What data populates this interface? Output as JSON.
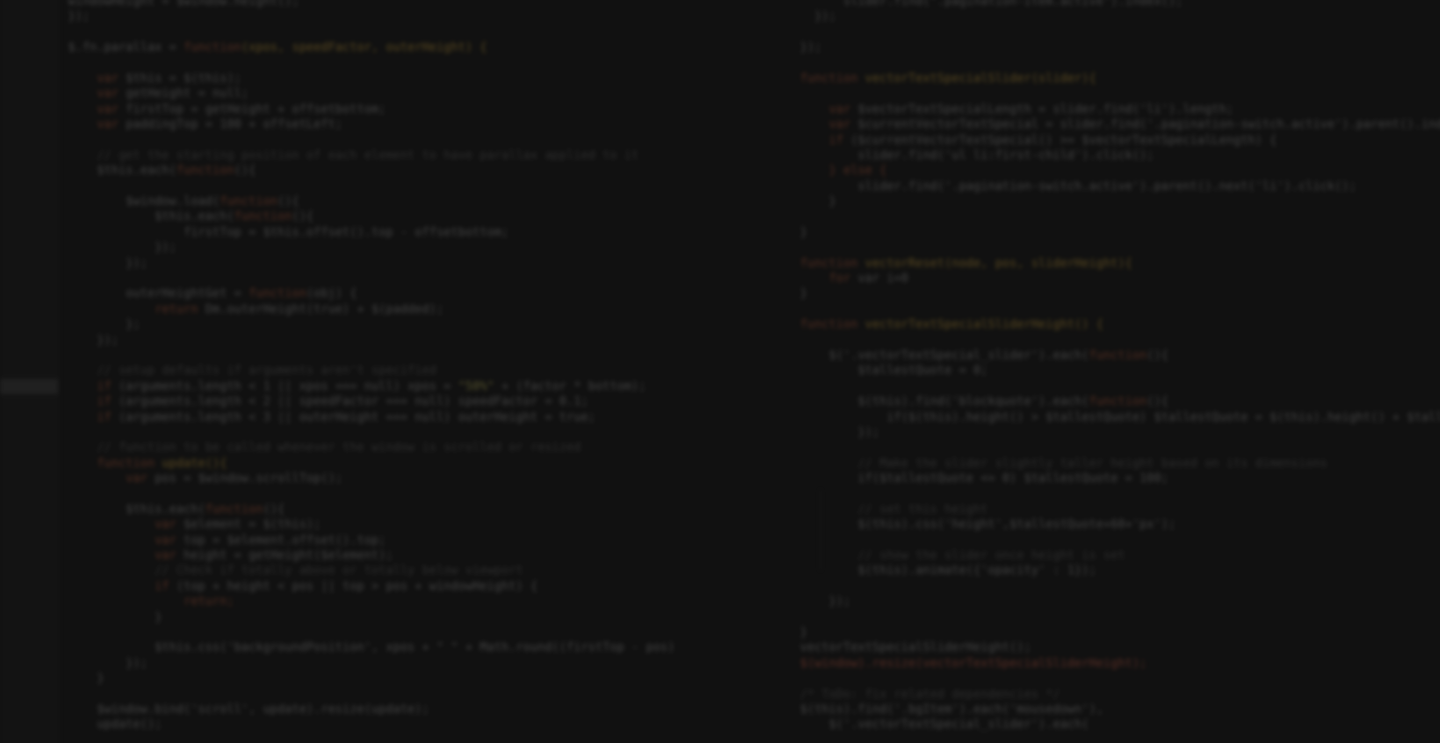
{
  "editor": {
    "active_line_index": 25,
    "line_numbers": [
      "",
      "",
      "",
      "",
      "",
      "",
      "",
      "",
      "",
      "",
      "",
      "",
      "",
      "",
      "",
      "",
      "",
      "",
      "",
      "",
      "",
      "",
      "",
      "",
      "",
      "",
      "",
      "",
      "",
      "",
      "",
      "",
      "",
      "",
      "",
      "",
      "",
      "",
      "",
      "",
      "",
      "",
      "",
      "",
      "",
      "",
      "",
      "",
      ""
    ],
    "left_lines": [
      [
        {
          "t": "windowHeight = $window.height();",
          "c": "var"
        }
      ],
      [
        {
          "t": "});",
          "c": "var"
        }
      ],
      [
        {
          "t": "",
          "c": "var"
        }
      ],
      [
        {
          "t": "$.fn.parallax = ",
          "c": "var"
        },
        {
          "t": "function",
          "c": "kw"
        },
        {
          "t": "(xpos, speedFactor, outerHeight) {",
          "c": "fn"
        }
      ],
      [
        {
          "t": "",
          "c": "var"
        }
      ],
      [
        {
          "t": "    var ",
          "c": "kw"
        },
        {
          "t": "$this = $(this);",
          "c": "var"
        }
      ],
      [
        {
          "t": "    var ",
          "c": "kw"
        },
        {
          "t": "getHeight = null;",
          "c": "var"
        }
      ],
      [
        {
          "t": "    var ",
          "c": "kw"
        },
        {
          "t": "firstTop = getHeight + offsetbottom;",
          "c": "var"
        }
      ],
      [
        {
          "t": "    var ",
          "c": "kw"
        },
        {
          "t": "paddingTop = 100 + offsetLeft;",
          "c": "var"
        }
      ],
      [
        {
          "t": "",
          "c": "var"
        }
      ],
      [
        {
          "t": "    // get the starting position of each element to have parallax applied to it",
          "c": "cm"
        }
      ],
      [
        {
          "t": "    $this.each(",
          "c": "var"
        },
        {
          "t": "function",
          "c": "kw"
        },
        {
          "t": "(){",
          "c": "var"
        }
      ],
      [
        {
          "t": "",
          "c": "var"
        }
      ],
      [
        {
          "t": "        $window.load(",
          "c": "var"
        },
        {
          "t": "function",
          "c": "kw"
        },
        {
          "t": "(){",
          "c": "var"
        }
      ],
      [
        {
          "t": "            $this.each(",
          "c": "var"
        },
        {
          "t": "function",
          "c": "kw"
        },
        {
          "t": "(){",
          "c": "var"
        }
      ],
      [
        {
          "t": "                firstTop = $this.offset().top - offsetbottom;",
          "c": "var"
        }
      ],
      [
        {
          "t": "            });",
          "c": "var"
        }
      ],
      [
        {
          "t": "        });",
          "c": "var"
        }
      ],
      [
        {
          "t": "",
          "c": "var"
        }
      ],
      [
        {
          "t": "        outerHeightGet = ",
          "c": "var"
        },
        {
          "t": "function",
          "c": "kw"
        },
        {
          "t": "(obj) {",
          "c": "var"
        }
      ],
      [
        {
          "t": "            return ",
          "c": "kw"
        },
        {
          "t": "Dm.outerHeight(true) + $(padded);",
          "c": "var"
        }
      ],
      [
        {
          "t": "        };",
          "c": "var"
        }
      ],
      [
        {
          "t": "    });",
          "c": "var"
        }
      ],
      [
        {
          "t": "",
          "c": "var"
        }
      ],
      [
        {
          "t": "    // setup defaults if arguments aren't specified",
          "c": "cm"
        }
      ],
      [
        {
          "t": "    if ",
          "c": "kw"
        },
        {
          "t": "(arguments.length < 1 || xpos === null) xpos = ",
          "c": "var"
        },
        {
          "t": "\"50%\"",
          "c": "str"
        },
        {
          "t": " + (factor * bottom);",
          "c": "var"
        }
      ],
      [
        {
          "t": "    if ",
          "c": "kw"
        },
        {
          "t": "(arguments.length < 2 || speedFactor === null) speedFactor = 0.1;",
          "c": "var"
        }
      ],
      [
        {
          "t": "    if ",
          "c": "kw"
        },
        {
          "t": "(arguments.length < 3 || outerHeight === null) outerHeight = true;",
          "c": "var"
        }
      ],
      [
        {
          "t": "",
          "c": "var"
        }
      ],
      [
        {
          "t": "    // function to be called whenever the window is scrolled or resized",
          "c": "cm"
        }
      ],
      [
        {
          "t": "    function ",
          "c": "kw"
        },
        {
          "t": "update(){",
          "c": "fn"
        }
      ],
      [
        {
          "t": "        var ",
          "c": "kw"
        },
        {
          "t": "pos = $window.scrollTop();",
          "c": "var"
        }
      ],
      [
        {
          "t": "",
          "c": "var"
        }
      ],
      [
        {
          "t": "        $this.each(",
          "c": "var"
        },
        {
          "t": "function",
          "c": "kw"
        },
        {
          "t": "(){",
          "c": "var"
        }
      ],
      [
        {
          "t": "            var ",
          "c": "kw"
        },
        {
          "t": "$element = $(this);",
          "c": "var"
        }
      ],
      [
        {
          "t": "            var ",
          "c": "kw"
        },
        {
          "t": "top = $element.offset().top;",
          "c": "var"
        }
      ],
      [
        {
          "t": "            var ",
          "c": "kw"
        },
        {
          "t": "height = getHeight($element);",
          "c": "var"
        }
      ],
      [
        {
          "t": "            // Check if totally above or totally below viewport",
          "c": "cm"
        }
      ],
      [
        {
          "t": "            if ",
          "c": "kw"
        },
        {
          "t": "(top + height < pos || top > pos + windowHeight) {",
          "c": "var"
        }
      ],
      [
        {
          "t": "                return;",
          "c": "kw"
        }
      ],
      [
        {
          "t": "            }",
          "c": "var"
        }
      ],
      [
        {
          "t": "",
          "c": "var"
        }
      ],
      [
        {
          "t": "            $this.css('backgroundPosition', xpos + \" \" + Math.round((firstTop - pos)",
          "c": "var"
        }
      ],
      [
        {
          "t": "        });",
          "c": "var"
        }
      ],
      [
        {
          "t": "    }",
          "c": "var"
        }
      ],
      [
        {
          "t": "",
          "c": "var"
        }
      ],
      [
        {
          "t": "    $window.bind('scroll', update).resize(update);",
          "c": "var"
        }
      ],
      [
        {
          "t": "    update();",
          "c": "var"
        }
      ]
    ],
    "right_lines": [
      [
        {
          "t": "      slider.find('.pagination-item.active').index();",
          "c": "var"
        }
      ],
      [
        {
          "t": "  });",
          "c": "var"
        }
      ],
      [
        {
          "t": "",
          "c": "var"
        }
      ],
      [
        {
          "t": "});",
          "c": "var"
        }
      ],
      [
        {
          "t": "",
          "c": "var"
        }
      ],
      [
        {
          "t": "function ",
          "c": "kw"
        },
        {
          "t": "vectorTextSpecialSlider(slider){",
          "c": "fn"
        }
      ],
      [
        {
          "t": "",
          "c": "var"
        }
      ],
      [
        {
          "t": "    var ",
          "c": "kw"
        },
        {
          "t": "$vectorTextSpecialLength = slider.find('li').length;",
          "c": "var"
        }
      ],
      [
        {
          "t": "    var ",
          "c": "kw"
        },
        {
          "t": "$currentVectorTextSpecial = slider.find('.pagination-switch.active').parent().index",
          "c": "var"
        }
      ],
      [
        {
          "t": "    if ",
          "c": "kw"
        },
        {
          "t": "($currentVectorTextSpecial() >= $vectorTextSpecialLength) {",
          "c": "var"
        }
      ],
      [
        {
          "t": "        slider.find('ul li:first-child').click();",
          "c": "var"
        }
      ],
      [
        {
          "t": "    } else {",
          "c": "kw"
        }
      ],
      [
        {
          "t": "        slider.find('.pagination-switch.active').parent().next('li').click();",
          "c": "var"
        }
      ],
      [
        {
          "t": "    }",
          "c": "var"
        }
      ],
      [
        {
          "t": "",
          "c": "var"
        }
      ],
      [
        {
          "t": "}",
          "c": "var"
        }
      ],
      [
        {
          "t": "",
          "c": "var"
        }
      ],
      [
        {
          "t": "function ",
          "c": "kw"
        },
        {
          "t": "vectorReset(node, pos, sliderHeight){",
          "c": "fn"
        }
      ],
      [
        {
          "t": "    for ",
          "c": "kw"
        },
        {
          "t": "var i=0",
          "c": "var"
        }
      ],
      [
        {
          "t": "}",
          "c": "var"
        }
      ],
      [
        {
          "t": "",
          "c": "var"
        }
      ],
      [
        {
          "t": "function ",
          "c": "kw"
        },
        {
          "t": "vectorTextSpecialSliderHeight() {",
          "c": "fn"
        }
      ],
      [
        {
          "t": "",
          "c": "var"
        }
      ],
      [
        {
          "t": "    $('.vectorTextSpecial_slider').each(",
          "c": "var"
        },
        {
          "t": "function",
          "c": "kw"
        },
        {
          "t": "(){",
          "c": "var"
        }
      ],
      [
        {
          "t": "        $tallestQuote = 0;",
          "c": "var"
        }
      ],
      [
        {
          "t": "",
          "c": "var"
        }
      ],
      [
        {
          "t": "        $(this).find('blockquote').each(",
          "c": "var"
        },
        {
          "t": "function",
          "c": "kw"
        },
        {
          "t": "(){",
          "c": "var"
        }
      ],
      [
        {
          "t": "            if($(this).height() > $tallestQuote) $tallestQuote = $(this).height() + $tall",
          "c": "var"
        }
      ],
      [
        {
          "t": "        });",
          "c": "var"
        }
      ],
      [
        {
          "t": "",
          "c": "var"
        }
      ],
      [
        {
          "t": "        // Make the slider slightly taller height based on its dimensions",
          "c": "cm"
        }
      ],
      [
        {
          "t": "        if($tallestQuote <= 0) $tallestQuote = 100;",
          "c": "var"
        }
      ],
      [
        {
          "t": "",
          "c": "var"
        }
      ],
      [
        {
          "t": "        // set this height",
          "c": "cm"
        }
      ],
      [
        {
          "t": "        $(this).css('height',$tallestQuote+60+'px');",
          "c": "var"
        }
      ],
      [
        {
          "t": "",
          "c": "var"
        }
      ],
      [
        {
          "t": "        // show the slider once height is set",
          "c": "cm"
        }
      ],
      [
        {
          "t": "        $(this).animate({'opacity' : 1});",
          "c": "var"
        }
      ],
      [
        {
          "t": "",
          "c": "var"
        }
      ],
      [
        {
          "t": "    });",
          "c": "var"
        }
      ],
      [
        {
          "t": "",
          "c": "var"
        }
      ],
      [
        {
          "t": "}",
          "c": "var"
        }
      ],
      [
        {
          "t": "vectorTextSpecialSliderHeight();",
          "c": "var"
        }
      ],
      [
        {
          "t": "$(window).resize(vectorTextSpecialSliderHeight);",
          "c": "dollar"
        }
      ],
      [
        {
          "t": "",
          "c": "var"
        }
      ],
      [
        {
          "t": "/* ToDo: fix related dependencies */",
          "c": "cm"
        }
      ],
      [
        {
          "t": "$(this).find('.bgItem').each('mousedown'),",
          "c": "var"
        }
      ],
      [
        {
          "t": "    $('.vectorTextSpecial_slider').each(",
          "c": "var"
        }
      ]
    ]
  }
}
